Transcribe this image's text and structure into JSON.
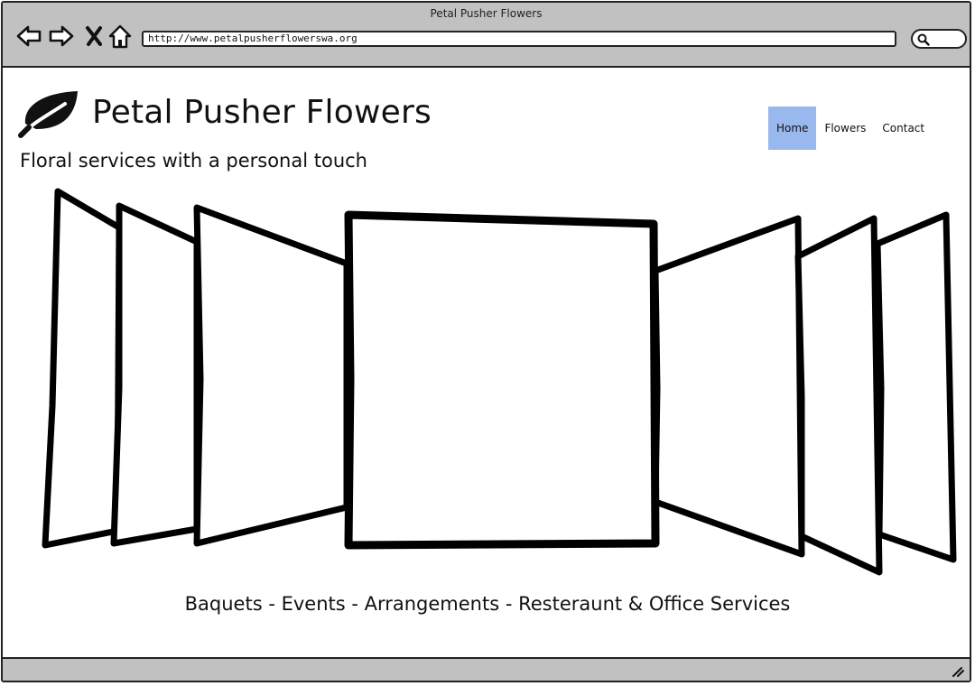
{
  "browser": {
    "window_title": "Petal Pusher Flowers",
    "url": "http://www.petalpusherflowerswa.org",
    "buttons": [
      "back-arrow-icon",
      "forward-arrow-icon",
      "close-x-icon",
      "home-icon"
    ],
    "search_icon": "magnifier-icon"
  },
  "site": {
    "logo_icon": "leaf-icon",
    "title": "Petal Pusher Flowers",
    "tagline": "Floral services with a personal touch",
    "nav": {
      "items": [
        {
          "label": "Home",
          "active": true
        },
        {
          "label": "Flowers",
          "active": false
        },
        {
          "label": "Contact",
          "active": false
        }
      ]
    },
    "carousel": {
      "slide_count": 7
    },
    "services_line": "Baquets - Events - Arrangements - Resteraunt & Office Services"
  },
  "colors": {
    "chrome": "#c1c1c1",
    "nav_active": "#99b8ee",
    "ink": "#111111"
  }
}
